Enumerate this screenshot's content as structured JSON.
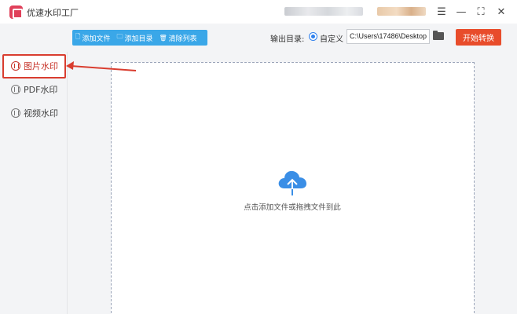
{
  "app": {
    "title": "优速水印工厂"
  },
  "window_controls": {
    "menu": "☰",
    "minimize": "—",
    "maximize": "⛶",
    "close": "✕"
  },
  "toolbar": {
    "buttons": [
      {
        "icon": "🗋",
        "label": "添加文件"
      },
      {
        "icon": "🗀",
        "label": "添加目录"
      },
      {
        "icon": "🗑",
        "label": "清除列表"
      }
    ],
    "output_label": "输出目录:",
    "radio_label": "自定义",
    "output_path": "C:\\Users\\17486\\Desktop",
    "start_label": "开始转换"
  },
  "sidebar": {
    "items": [
      {
        "label": "图片水印",
        "active": true
      },
      {
        "label": "PDF水印",
        "active": false
      },
      {
        "label": "视频水印",
        "active": false
      }
    ]
  },
  "drop_zone": {
    "text": "点击添加文件或拖拽文件到此"
  },
  "colors": {
    "accent_blue": "#3aa7e8",
    "start_red": "#e84c2b",
    "highlight_red": "#d93d2f",
    "cloud_blue": "#3a8ee6"
  }
}
